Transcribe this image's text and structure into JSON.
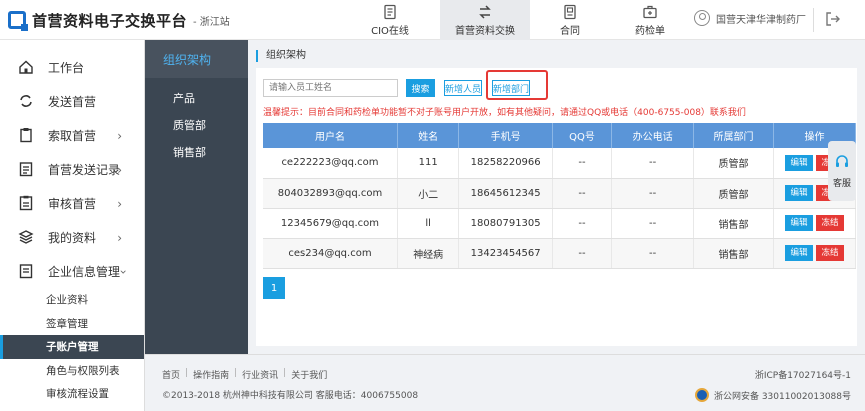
{
  "header": {
    "brand": "首营资料电子交换平台",
    "region": "- 浙江站",
    "nav": [
      {
        "label": "CIO在线"
      },
      {
        "label": "首营资料交换"
      },
      {
        "label": "合同"
      },
      {
        "label": "药检单"
      }
    ],
    "user_name": "国营天津华津制药厂"
  },
  "sidebar": {
    "items": [
      {
        "label": "工作台"
      },
      {
        "label": "发送首营"
      },
      {
        "label": "索取首营"
      },
      {
        "label": "首营发送记录"
      },
      {
        "label": "审核首营"
      },
      {
        "label": "我的资料"
      },
      {
        "label": "企业信息管理"
      }
    ],
    "subitems": [
      {
        "label": "企业资料"
      },
      {
        "label": "签章管理"
      },
      {
        "label": "子账户管理"
      },
      {
        "label": "角色与权限列表"
      },
      {
        "label": "审核流程设置"
      }
    ]
  },
  "org_menu": {
    "title": "组织架构",
    "depts": [
      {
        "label": "产品"
      },
      {
        "label": "质管部"
      },
      {
        "label": "销售部"
      }
    ]
  },
  "main": {
    "breadcrumb": "组织架构",
    "search_placeholder": "请输入员工姓名",
    "search_button": "搜索",
    "add_user_button": "新增人员",
    "add_dept_button": "新增部门",
    "notice": "温馨提示：目前合同和药检单功能暂不对子账号用户开放，如有其他疑问，请通过QQ或电话（400-6755-008）联系我们",
    "table": {
      "headers": [
        "用户名",
        "姓名",
        "手机号",
        "QQ号",
        "办公电话",
        "所属部门",
        "操作"
      ],
      "rows": [
        {
          "username": "ce222223@qq.com",
          "name": "111",
          "phone": "18258220966",
          "qq": "--",
          "office": "--",
          "dept": "质管部"
        },
        {
          "username": "804032893@qq.com",
          "name": "小二",
          "phone": "18645612345",
          "qq": "--",
          "office": "--",
          "dept": "质管部"
        },
        {
          "username": "12345679@qq.com",
          "name": "ll",
          "phone": "18080791305",
          "qq": "--",
          "office": "--",
          "dept": "销售部"
        },
        {
          "username": "ces234@qq.com",
          "name": "神经病",
          "phone": "13423454567",
          "qq": "--",
          "office": "--",
          "dept": "销售部"
        }
      ],
      "edit_label": "编辑",
      "freeze_label": "冻结"
    },
    "page": "1"
  },
  "customer_service": "客服",
  "footer": {
    "links": [
      "首页",
      "操作指南",
      "行业资讯",
      "关于我们"
    ],
    "copyright": "©2013-2018   杭州神中科技有限公司   客服电话：4006755008",
    "icp": "浙ICP备17027164号-1",
    "police": "浙公网安备 33011002013088号"
  },
  "colors": {
    "primary": "#1a9ee0",
    "table_header": "#5a95d8",
    "danger": "#e53935",
    "sidebar_dark": "#3b4652"
  }
}
